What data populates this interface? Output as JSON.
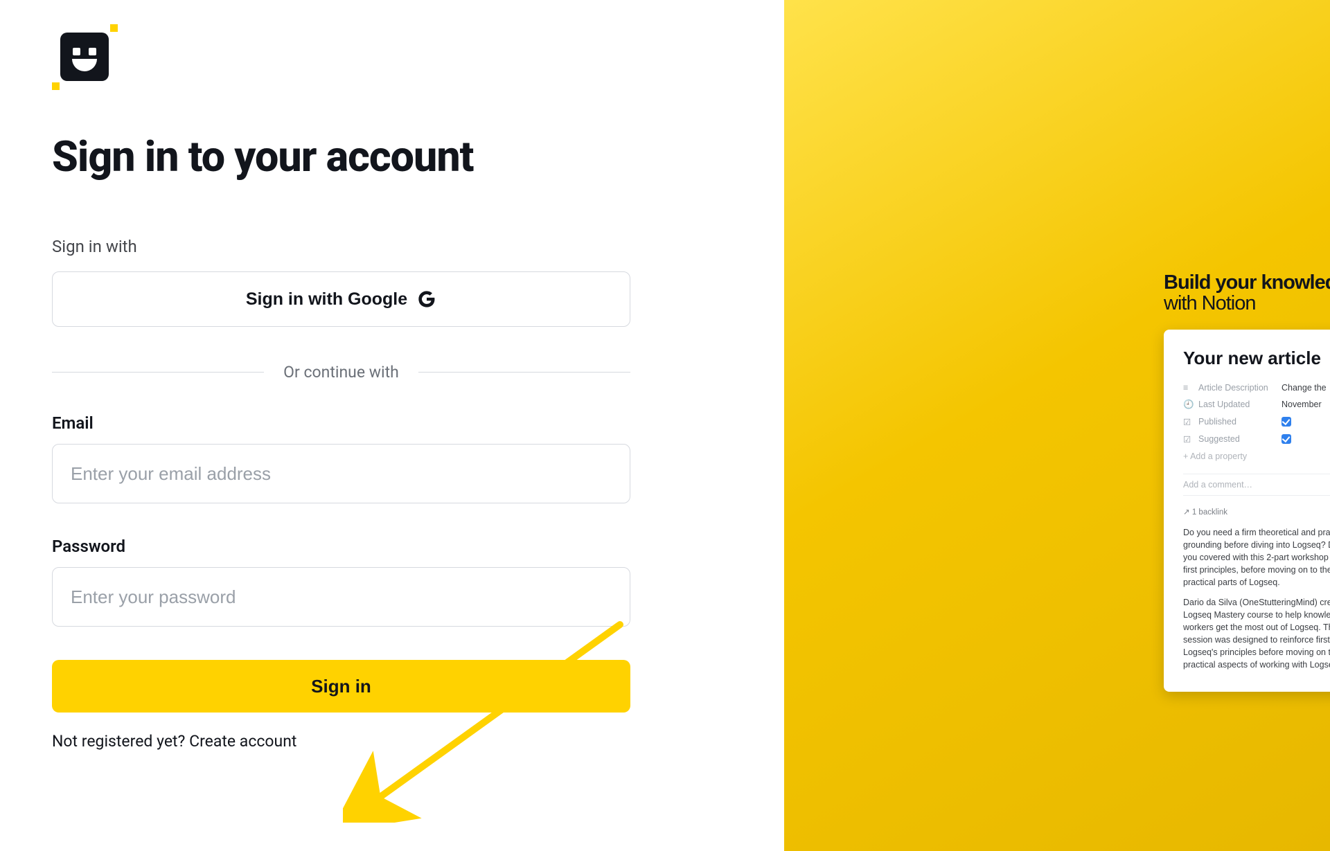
{
  "colors": {
    "accent": "#ffd200",
    "text": "#12151c",
    "muted": "#9aa0a8",
    "border": "#d6d9df"
  },
  "signin": {
    "title": "Sign in to your account",
    "sign_in_with_label": "Sign in with",
    "google_button": "Sign in with Google",
    "divider": "Or continue with",
    "email_label": "Email",
    "email_placeholder": "Enter your email address",
    "password_label": "Password",
    "password_placeholder": "Enter your password",
    "submit": "Sign in",
    "footer_q": "Not registered yet? ",
    "footer_link": "Create account"
  },
  "promo": {
    "heading_line1": "Build your knowledge base",
    "heading_line2": "with Notion",
    "card": {
      "title": "Your new article",
      "props": [
        {
          "icon": "≡",
          "label": "Article Description",
          "value": "Change the"
        },
        {
          "icon": "🕘",
          "label": "Last Updated",
          "value": "November"
        },
        {
          "icon": "☑",
          "label": "Published",
          "checked": true
        },
        {
          "icon": "☑",
          "label": "Suggested",
          "checked": true
        }
      ],
      "add_property": "+  Add a property",
      "add_comment": "Add a comment…",
      "backlinks": "↗ 1 backlink",
      "para1": "Do you need a firm theoretical and practical grounding before diving into Logseq? Dario has you covered with this 2-part workshop covering first principles, before moving on to the practical parts of Logseq.",
      "para2": "Dario da Silva (OneStutteringMind) created the Logseq Mastery course to help knowledge workers get the most out of Logseq. This 2-part session was designed to reinforce first Logseq's principles before moving on to the practical aspects of working with Logseq."
    }
  }
}
